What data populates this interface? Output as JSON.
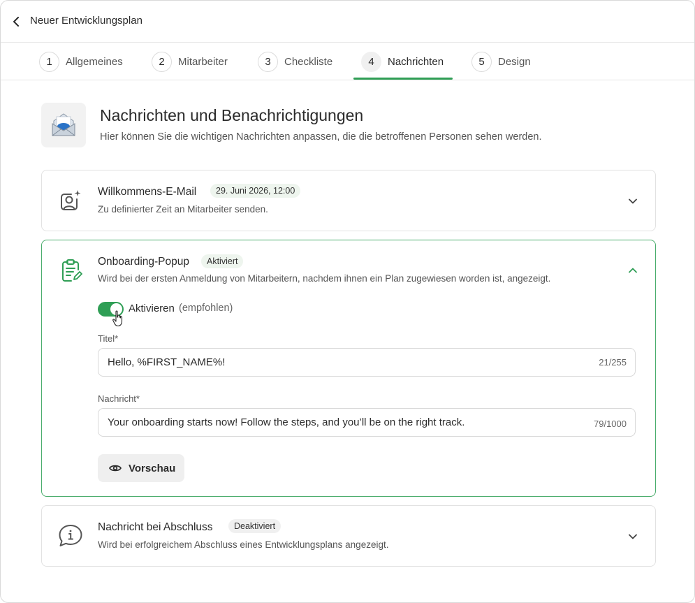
{
  "header": {
    "title": "Neuer Entwicklungsplan",
    "back_icon": "chevron-left-icon"
  },
  "tabs": [
    {
      "num": "1",
      "label": "Allgemeines"
    },
    {
      "num": "2",
      "label": "Mitarbeiter"
    },
    {
      "num": "3",
      "label": "Checkliste"
    },
    {
      "num": "4",
      "label": "Nachrichten",
      "active": true
    },
    {
      "num": "5",
      "label": "Design"
    }
  ],
  "hero": {
    "icon": "envelope-icon",
    "title": "Nachrichten und Benachrichtigungen",
    "subtitle": "Hier können Sie die wichtigen Nachrichten anpassen, die die betroffenen Personen sehen werden."
  },
  "cards": {
    "welcome": {
      "icon": "user-sparkle-icon",
      "title": "Willkommens-E-Mail",
      "badge": "29. Juni 2026, 12:00",
      "subtitle": "Zu definierter Zeit an Mitarbeiter senden."
    },
    "onboarding": {
      "icon": "clipboard-edit-icon",
      "title": "Onboarding-Popup",
      "badge": "Aktiviert",
      "subtitle": "Wird bei der ersten Anmeldung von Mitarbeitern, nachdem ihnen ein Plan zugewiesen worden ist, angezeigt.",
      "toggle_label": "Aktivieren",
      "toggle_hint": "(empfohlen)",
      "toggle_on": true,
      "title_field": {
        "label": "Titel*",
        "value": "Hello, %FIRST_NAME%!",
        "counter": "21/255"
      },
      "message_field": {
        "label": "Nachricht*",
        "value": "Your onboarding starts now! Follow the steps, and you’ll be on the right track.",
        "counter": "79/1000"
      },
      "preview_label": "Vorschau"
    },
    "completion": {
      "icon": "info-bubble-icon",
      "title": "Nachricht bei Abschluss",
      "badge": "Deaktiviert",
      "subtitle": "Wird bei erfolgreichem Abschluss eines Entwicklungsplans angezeigt."
    }
  },
  "colors": {
    "accent": "#2f9e55",
    "card_open_border": "#4bad6d"
  }
}
